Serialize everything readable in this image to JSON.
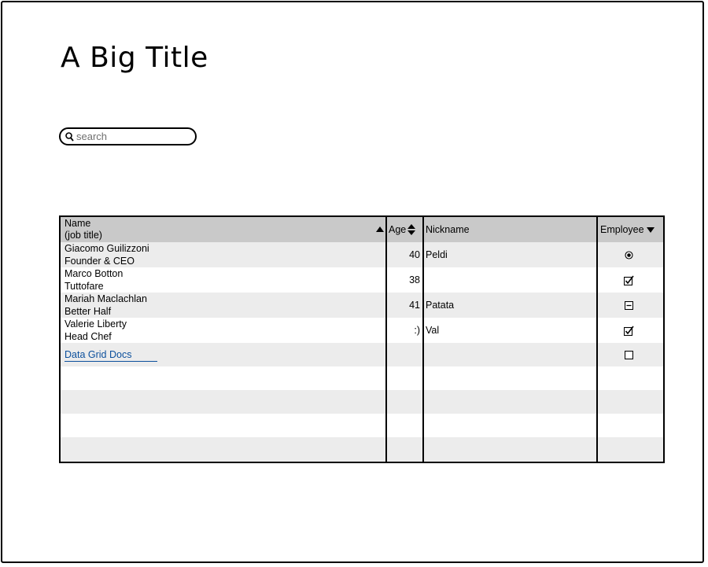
{
  "page": {
    "title": "A Big Title"
  },
  "search": {
    "placeholder": "search",
    "icon": "search-icon"
  },
  "grid": {
    "columns": [
      {
        "label_line1": "Name",
        "label_line2": "(job title)",
        "sort": "ascending"
      },
      {
        "label": "Age",
        "sort": "both"
      },
      {
        "label": "Nickname"
      },
      {
        "label": "Employee",
        "sort": "dropdown"
      }
    ],
    "rows": [
      {
        "name": "Giacomo Guilizzoni",
        "title": "Founder & CEO",
        "age": "40",
        "nickname": "Peldi",
        "employee": "radio-selected"
      },
      {
        "name": "Marco Botton",
        "title": "Tuttofare",
        "age": "38",
        "nickname": "",
        "employee": "checked"
      },
      {
        "name": "Mariah Maclachlan",
        "title": "Better Half",
        "age": "41",
        "nickname": "Patata",
        "employee": "indeterminate"
      },
      {
        "name": "Valerie Liberty",
        "title": "Head Chef",
        "age": ":)",
        "nickname": "Val",
        "employee": "checked"
      }
    ],
    "link_row": {
      "link_text": "Data Grid Docs",
      "employee": "unchecked"
    }
  },
  "colors": {
    "header_bg": "#c9c9c9",
    "alt_row_bg": "#ececec",
    "link": "#0b4f9c"
  }
}
